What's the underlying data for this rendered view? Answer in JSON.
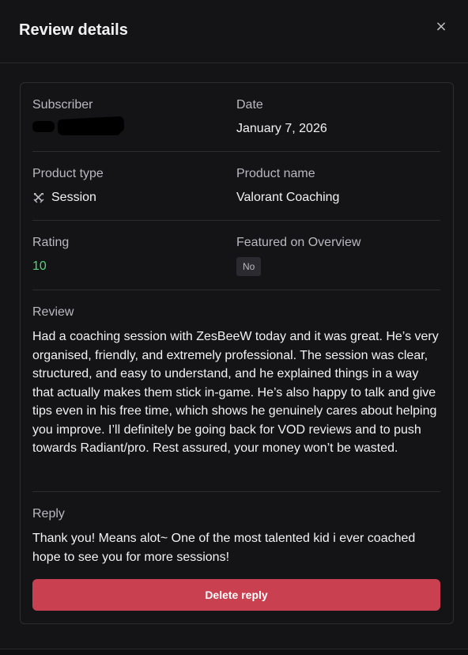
{
  "header": {
    "title": "Review details",
    "close_icon": "close-icon",
    "close_glyph": "×"
  },
  "details": {
    "subscriber_label": "Subscriber",
    "date_label": "Date",
    "date_value": "January 7, 2026",
    "product_type_label": "Product type",
    "product_type_value": "Session",
    "product_type_icon": "crossed-swords-icon",
    "product_name_label": "Product name",
    "product_name_value": "Valorant Coaching",
    "rating_label": "Rating",
    "rating_value": "10",
    "featured_label": "Featured on Overview",
    "featured_value": "No"
  },
  "review": {
    "label": "Review",
    "text": "Had a coaching session with ZesBeeW today and it was great. He’s very organised, friendly, and extremely professional. The session was clear, structured, and easy to understand, and he explained things in a way that actually makes them stick in-game. He’s also happy to talk and give tips even in his free time, which shows he genuinely cares about helping you improve. I’ll definitely be going back for VOD reviews and to push towards Radiant/pro. Rest assured, your money won’t be wasted."
  },
  "reply": {
    "label": "Reply",
    "text": "Thank you! Means alot~ One of the most talented kid i ever coached hope to see you for more sessions!",
    "delete_label": "Delete reply"
  },
  "colors": {
    "rating": "#57d27a",
    "delete_button": "#c94050",
    "background": "#141417"
  }
}
